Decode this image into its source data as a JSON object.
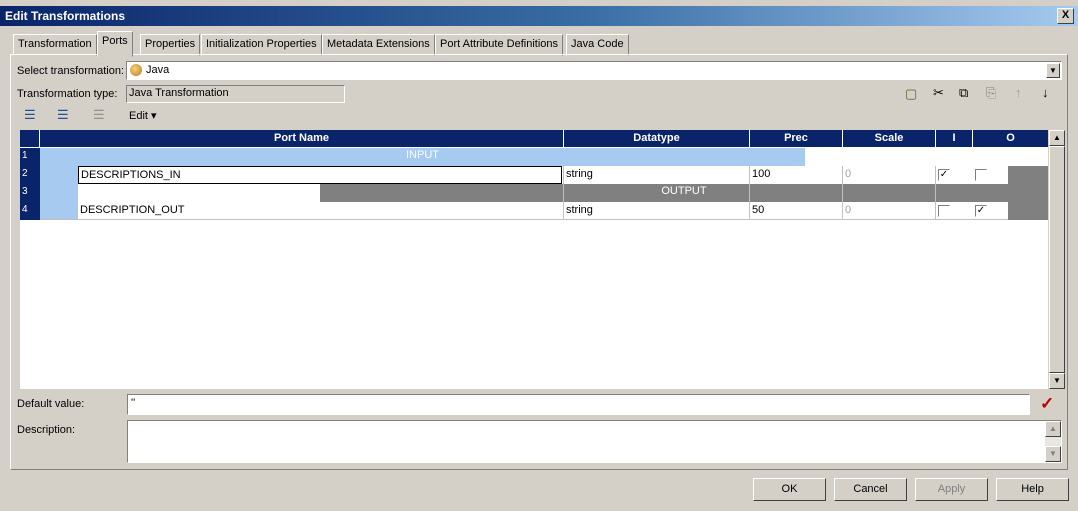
{
  "window": {
    "title": "Edit Transformations",
    "close_glyph": "X"
  },
  "tabs": [
    {
      "label": "Transformation"
    },
    {
      "label": "Ports"
    },
    {
      "label": "Properties"
    },
    {
      "label": "Initialization Properties"
    },
    {
      "label": "Metadata Extensions"
    },
    {
      "label": "Port Attribute Definitions"
    },
    {
      "label": "Java Code"
    }
  ],
  "active_tab": "Ports",
  "select_transformation": {
    "label": "Select transformation:",
    "value": "Java"
  },
  "transformation_type": {
    "label": "Transformation type:",
    "value": "Java Transformation"
  },
  "edit_menu": {
    "label": "Edit"
  },
  "grid": {
    "columns": [
      "Port Name",
      "Datatype",
      "Prec",
      "Scale",
      "I",
      "O"
    ],
    "rows": [
      {
        "num": "1",
        "group": "INPUT"
      },
      {
        "num": "2",
        "name": "DESCRIPTIONS_IN",
        "datatype": "string",
        "prec": "100",
        "scale": "0",
        "input": true,
        "output": false
      },
      {
        "num": "3",
        "group": "OUTPUT"
      },
      {
        "num": "4",
        "name": "DESCRIPTION_OUT",
        "datatype": "string",
        "prec": "50",
        "scale": "0",
        "input": false,
        "output": true
      }
    ]
  },
  "default_value": {
    "label": "Default value:",
    "value": "''"
  },
  "description": {
    "label": "Description:",
    "value": ""
  },
  "buttons": {
    "ok": "OK",
    "cancel": "Cancel",
    "apply": "Apply",
    "help": "Help"
  },
  "colors": {
    "header": "#0a246a",
    "group_input": "#a6caf0",
    "group_output": "#808080",
    "validate_check": "#c00000"
  }
}
